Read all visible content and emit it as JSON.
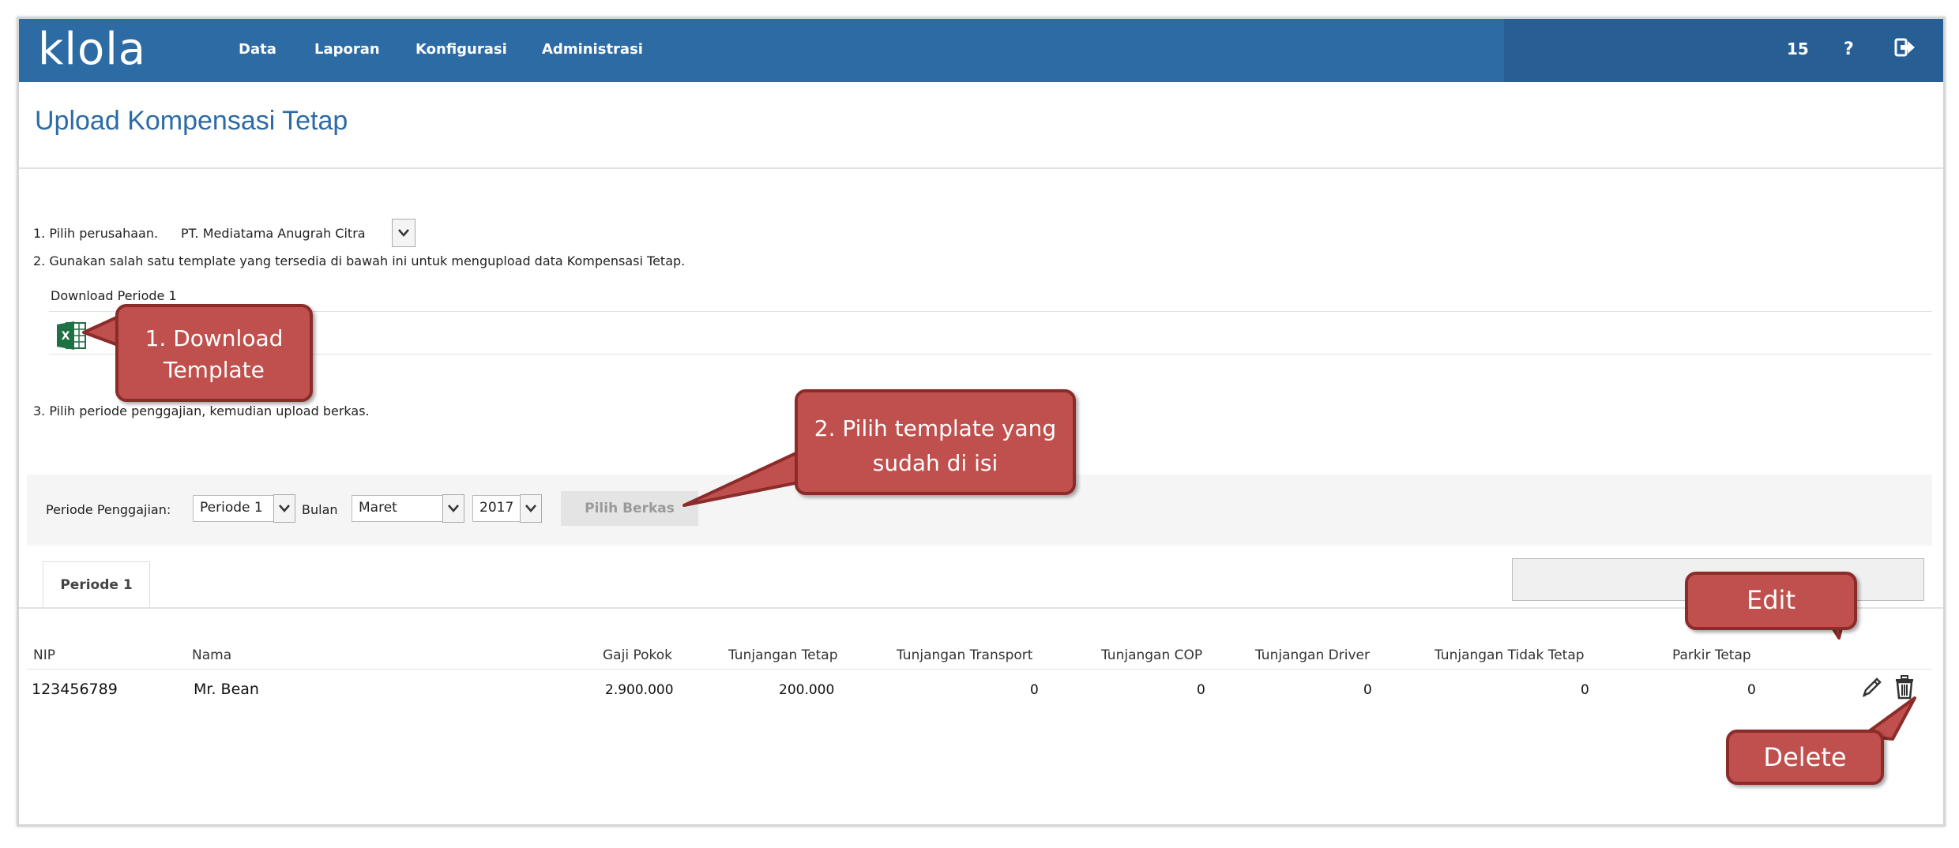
{
  "app": {
    "logo": "klola",
    "nav": [
      "Data",
      "Laporan",
      "Konfigurasi",
      "Administrasi"
    ],
    "badge": "15",
    "help": "?",
    "logout_icon": "logout-icon"
  },
  "page": {
    "title": "Upload Kompensasi Tetap",
    "step1_label": "1. Pilih perusahaan.",
    "company": "PT. Mediatama Anugrah Citra",
    "step2_label": "2. Gunakan salah satu template yang tersedia di bawah ini untuk mengupload data Kompensasi Tetap.",
    "download_header": "Download Periode 1",
    "excel_icon": "excel-icon",
    "step3_label": "3. Pilih periode penggajian, kemudian upload berkas."
  },
  "filter": {
    "periode_label": "Periode Penggajian:",
    "periode_value": "Periode 1",
    "bulan_label": "Bulan",
    "bulan_value": "Maret",
    "tahun_value": "2017",
    "pilih_berkas": "Pilih Berkas"
  },
  "tabs": [
    "Periode 1"
  ],
  "table": {
    "headers": [
      "NIP",
      "Nama",
      "Gaji Pokok",
      "Tunjangan Tetap",
      "Tunjangan Transport",
      "Tunjangan COP",
      "Tunjangan Driver",
      "Tunjangan Tidak Tetap",
      "Parkir Tetap"
    ],
    "rows": [
      [
        "123456789",
        "Mr. Bean",
        "2.900.000",
        "200.000",
        "0",
        "0",
        "0",
        "0",
        "0"
      ]
    ]
  },
  "callouts": {
    "download": [
      "1. Download",
      "Template"
    ],
    "pilih": [
      "2. Pilih template yang",
      "sudah di isi"
    ],
    "edit": "Edit",
    "delete": "Delete"
  },
  "colors": {
    "navbar": "#2d6ba5",
    "callout": "#c0504d",
    "title": "#2d6ba5"
  }
}
